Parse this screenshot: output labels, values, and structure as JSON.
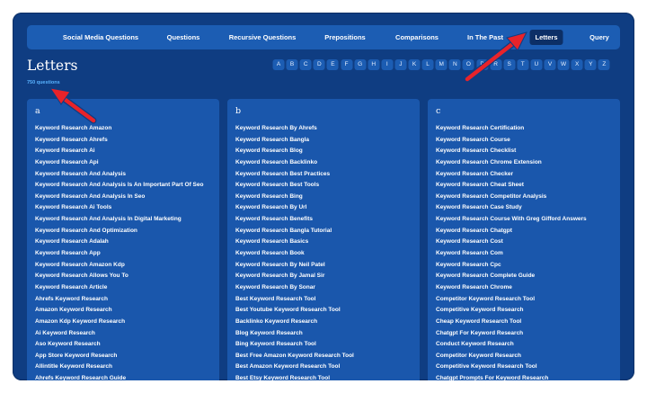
{
  "nav": {
    "items": [
      {
        "label": "Social Media Questions",
        "active": false
      },
      {
        "label": "Questions",
        "active": false
      },
      {
        "label": "Recursive Questions",
        "active": false
      },
      {
        "label": "Prepositions",
        "active": false
      },
      {
        "label": "Comparisons",
        "active": false
      },
      {
        "label": "In The Past",
        "active": false
      },
      {
        "label": "Letters",
        "active": true
      },
      {
        "label": "Query",
        "active": false
      }
    ]
  },
  "page": {
    "title": "Letters",
    "count": "750 questions"
  },
  "alphabet": [
    "A",
    "B",
    "C",
    "D",
    "E",
    "F",
    "G",
    "H",
    "I",
    "J",
    "K",
    "L",
    "M",
    "N",
    "O",
    "P",
    "R",
    "S",
    "T",
    "U",
    "V",
    "W",
    "X",
    "Y",
    "Z"
  ],
  "columns": [
    {
      "heading": "a",
      "items": [
        "Keyword Research Amazon",
        "Keyword Research Ahrefs",
        "Keyword Research Ai",
        "Keyword Research Api",
        "Keyword Research And Analysis",
        "Keyword Research And Analysis Is An Important Part Of Seo",
        "Keyword Research And Analysis In Seo",
        "Keyword Research Ai Tools",
        "Keyword Research And Analysis In Digital Marketing",
        "Keyword Research And Optimization",
        "Keyword Research Adalah",
        "Keyword Research App",
        "Keyword Research Amazon Kdp",
        "Keyword Research Allows You To",
        "Keyword Research Article",
        "Ahrefs Keyword Research",
        "Amazon Keyword Research",
        "Amazon Kdp Keyword Research",
        "Ai Keyword Research",
        "Aso Keyword Research",
        "App Store Keyword Research",
        "Allintitle Keyword Research",
        "Ahrefs Keyword Research Guide"
      ]
    },
    {
      "heading": "b",
      "items": [
        "Keyword Research By Ahrefs",
        "Keyword Research Bangla",
        "Keyword Research Blog",
        "Keyword Research Backlinko",
        "Keyword Research Best Practices",
        "Keyword Research Best Tools",
        "Keyword Research Bing",
        "Keyword Research By Url",
        "Keyword Research Benefits",
        "Keyword Research Bangla Tutorial",
        "Keyword Research Basics",
        "Keyword Research Book",
        "Keyword Research By Neil Patel",
        "Keyword Research By Jamal Sir",
        "Keyword Research By Sonar",
        "Best Keyword Research Tool",
        "Best Youtube Keyword Research Tool",
        "Backlinko Keyword Research",
        "Blog Keyword Research",
        "Bing Keyword Research Tool",
        "Best Free Amazon Keyword Research Tool",
        "Best Amazon Keyword Research Tool",
        "Best Etsy Keyword Research Tool"
      ]
    },
    {
      "heading": "c",
      "items": [
        "Keyword Research Certification",
        "Keyword Research Course",
        "Keyword Research Checklist",
        "Keyword Research Chrome Extension",
        "Keyword Research Checker",
        "Keyword Research Cheat Sheet",
        "Keyword Research Competitor Analysis",
        "Keyword Research Case Study",
        "Keyword Research Course With Greg Gifford Answers",
        "Keyword Research Chatgpt",
        "Keyword Research Cost",
        "Keyword Research Com",
        "Keyword Research Cpc",
        "Keyword Research Complete Guide",
        "Keyword Research Chrome",
        "Competitor Keyword Research Tool",
        "Competitive Keyword Research",
        "Cheap Keyword Research Tool",
        "Chatgpt For Keyword Research",
        "Conduct Keyword Research",
        "Competitor Keyword Research",
        "Competitive Keyword Research Tool",
        "Chatgpt Prompts For Keyword Research"
      ]
    }
  ],
  "annotations": {
    "arrow_color": "#e8232a"
  }
}
